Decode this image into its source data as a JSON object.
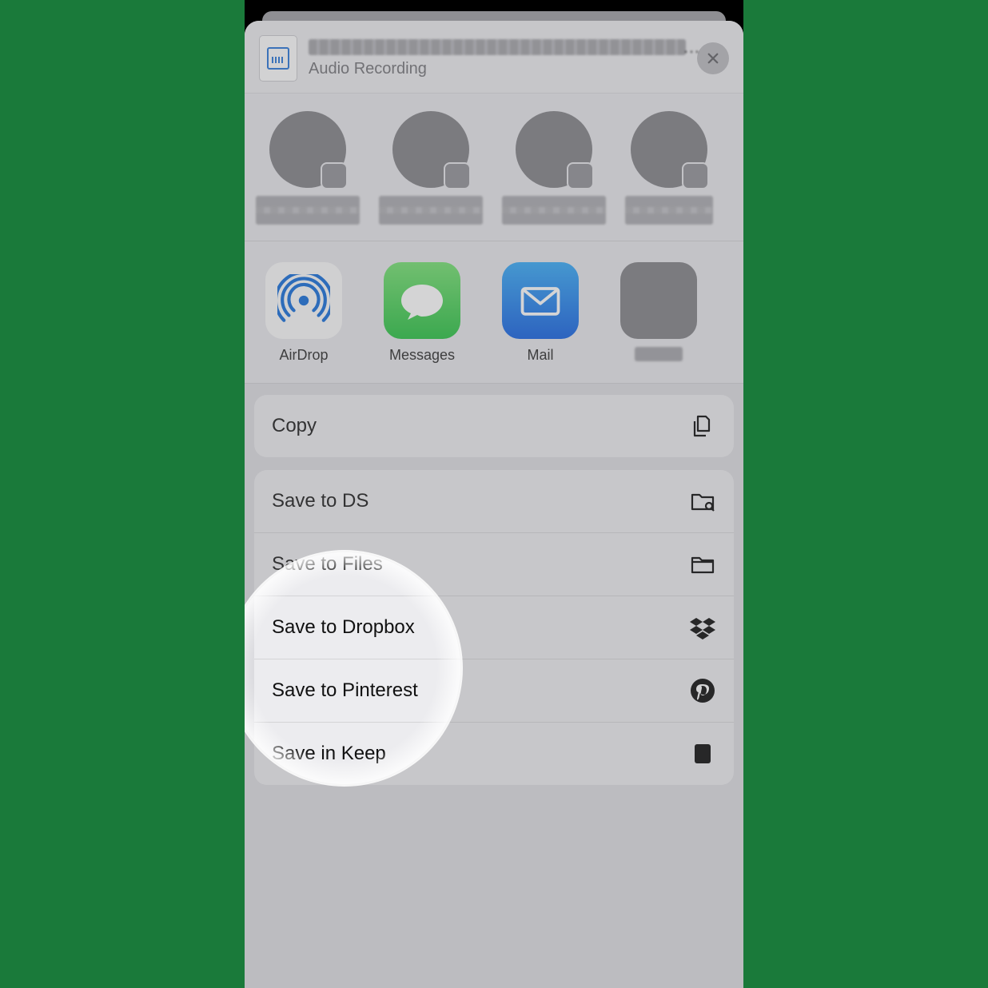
{
  "header": {
    "subtitle": "Audio Recording"
  },
  "apps": [
    {
      "label": "AirDrop"
    },
    {
      "label": "Messages"
    },
    {
      "label": "Mail"
    },
    {
      "label": ""
    }
  ],
  "actions_primary": [
    {
      "label": "Copy",
      "icon": "copy"
    }
  ],
  "actions_secondary": [
    {
      "label": "Save to DS",
      "icon": "folder-search"
    },
    {
      "label": "Save to Files",
      "icon": "folder"
    },
    {
      "label": "Save to Dropbox",
      "icon": "dropbox"
    },
    {
      "label": "Save to Pinterest",
      "icon": "pinterest"
    },
    {
      "label": "Save in Keep",
      "icon": "keep"
    }
  ]
}
